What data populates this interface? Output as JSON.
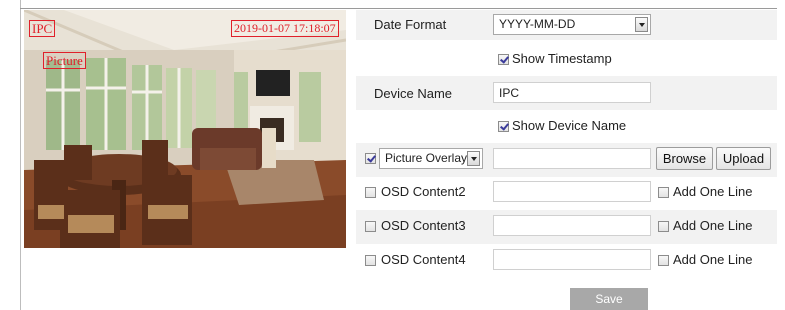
{
  "preview": {
    "overlay_name": "IPC",
    "overlay_timestamp": "2019-01-07 17:18:07",
    "overlay_picture": "Picture"
  },
  "form": {
    "date_format": {
      "label": "Date Format",
      "value": "YYYY-MM-DD"
    },
    "show_timestamp": {
      "label": "Show Timestamp",
      "checked": true
    },
    "device_name": {
      "label": "Device Name",
      "value": "IPC"
    },
    "show_device_name": {
      "label": "Show Device Name",
      "checked": true
    },
    "picture_overlay": {
      "label": "Picture Overlay",
      "checked": true,
      "value": ""
    },
    "browse_label": "Browse",
    "upload_label": "Upload",
    "osd": [
      {
        "label": "OSD Content2",
        "checked": false,
        "value": "",
        "add_line_label": "Add One Line"
      },
      {
        "label": "OSD Content3",
        "checked": false,
        "value": "",
        "add_line_label": "Add One Line"
      },
      {
        "label": "OSD Content4",
        "checked": false,
        "value": "",
        "add_line_label": "Add One Line"
      }
    ],
    "save_label": "Save"
  },
  "colors": {
    "overlay_red": "#e0202a",
    "save_bg": "#a8a8a8",
    "row_bg": "#f2f2f2"
  },
  "icons": [
    "checkbox-checked-icon",
    "checkbox-unchecked-icon",
    "dropdown-arrow-icon"
  ]
}
